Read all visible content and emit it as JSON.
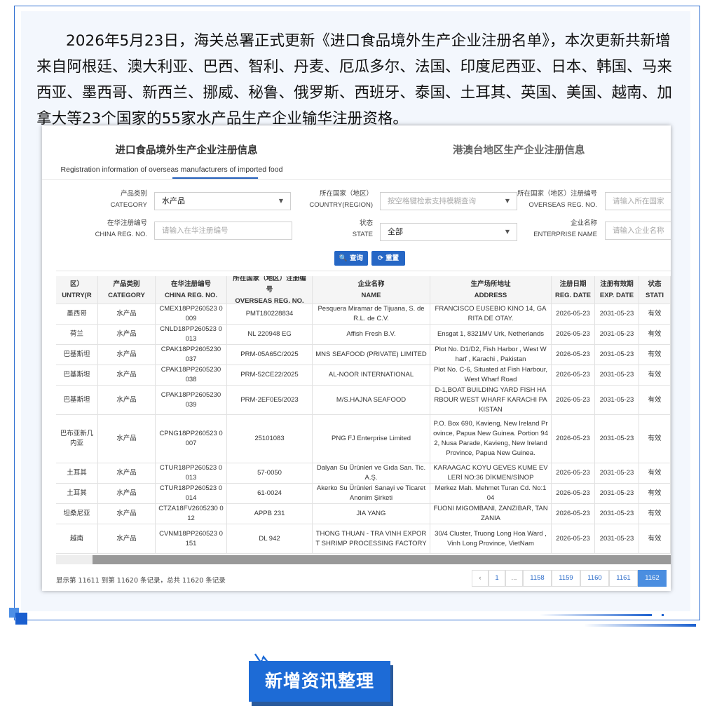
{
  "intro_text": "2026年5月23日，海关总署正式更新《进口食品境外生产企业注册名单》，本次更新共新增来自阿根廷、澳大利亚、巴西、智利、丹麦、厄瓜多尔、法国、印度尼西亚、日本、韩国、马来西亚、墨西哥、新西兰、挪威、秘鲁、俄罗斯、西班牙、泰国、土耳其、英国、美国、越南、加拿大等23个国家的55家水产品生产企业输华注册资格。",
  "tabs": {
    "main_cn": "进口食品境外生产企业注册信息",
    "main_en": "Registration information of overseas manufacturers of imported food",
    "second_cn": "港澳台地区生产企业注册信息"
  },
  "filters": {
    "category": {
      "label_cn": "产品类别",
      "label_en": "CATEGORY",
      "value": "水产品"
    },
    "country": {
      "label_cn": "所在国家（地区）",
      "label_en": "COUNTRY(REGION)",
      "placeholder": "按空格键检索支持模糊查询"
    },
    "overseas_reg": {
      "label_cn": "所在国家（地区）注册编号",
      "label_en": "OVERSEAS REG. NO.",
      "placeholder": "请输入所在国家"
    },
    "china_reg": {
      "label_cn": "在华注册编号",
      "label_en": "CHINA REG. NO.",
      "placeholder": "请输入在华注册编号"
    },
    "state": {
      "label_cn": "状态",
      "label_en": "STATE",
      "value": "全部"
    },
    "enterprise": {
      "label_cn": "企业名称",
      "label_en": "ENTERPRISE NAME",
      "placeholder": "请输入企业名称"
    }
  },
  "buttons": {
    "query": "🔍 查询",
    "reset": "⟳ 重置"
  },
  "table": {
    "headers": [
      {
        "cn": "国家（地区）",
        "en": "UNTRY(RE..."
      },
      {
        "cn": "产品类别",
        "en": "CATEGORY"
      },
      {
        "cn": "在华注册编号",
        "en": "CHINA REG. NO."
      },
      {
        "cn": "所在国家（地区）注册编号",
        "en": "OVERSEAS REG. NO."
      },
      {
        "cn": "企业名称",
        "en": "NAME"
      },
      {
        "cn": "生产场所地址",
        "en": "ADDRESS"
      },
      {
        "cn": "注册日期",
        "en": "REG. DATE"
      },
      {
        "cn": "注册有效期",
        "en": "EXP. DATE"
      },
      {
        "cn": "状态",
        "en": "STATI"
      }
    ],
    "rows": [
      [
        "墨西哥",
        "水产品",
        "CMEX18PP260523 0009",
        "PMT180228834",
        "Pesquera Miramar de Tijuana, S. de R.L. de C.V.",
        "FRANCISCO EUSEBIO KINO 14, GARITA DE OTAY.",
        "2026-05-23",
        "2031-05-23",
        "有效"
      ],
      [
        "荷兰",
        "水产品",
        "CNLD18PP260523 0013",
        "NL 220948 EG",
        "Affish Fresh B.V.",
        "Ensgat 1, 8321MV Urk, Netherlands",
        "2026-05-23",
        "2031-05-23",
        "有效"
      ],
      [
        "巴基斯坦",
        "水产品",
        "CPAK18PP2605230 037",
        "PRM-05A65C/2025",
        "MNS SEAFOOD (PRIVATE) LIMITED",
        "Plot No. D1/D2, Fish Harbor , West Wharf , Karachi , Pakistan",
        "2026-05-23",
        "2031-05-23",
        "有效"
      ],
      [
        "巴基斯坦",
        "水产品",
        "CPAK18PP2605230 038",
        "PRM-52CE22/2025",
        "AL-NOOR INTERNATIONAL",
        "Plot No. C-6, Situated at Fish Harbour, West Wharf Road",
        "2026-05-23",
        "2031-05-23",
        "有效"
      ],
      [
        "巴基斯坦",
        "水产品",
        "CPAK18PP2605230 039",
        "PRM-2EF0E5/2023",
        "M/S.HAJNA SEAFOOD",
        "D-1,BOAT BUILDING YARD FISH HARBOUR WEST WHARF KARACHI PAKISTAN",
        "2026-05-23",
        "2031-05-23",
        "有效"
      ],
      [
        "巴布亚新几内亚",
        "水产品",
        "CPNG18PP260523 0007",
        "25101083",
        "PNG FJ Enterprise Limited",
        "P.O. Box 690, Kavieng, New Ireland Province, Papua New Guinea. Portion 942, Nusa Parade, Kavieng, New Ireland Province, Papua New Guinea.",
        "2026-05-23",
        "2031-05-23",
        "有效"
      ],
      [
        "土耳其",
        "水产品",
        "CTUR18PP260523 0013",
        "57-0050",
        "Dalyan Su Ürünleri ve Gıda San. Tic. A.Ş.",
        "KARAAGAC KOYU GEVES KUME EVLERİ NO:36 DİKMEN/SİNOP",
        "2026-05-23",
        "2031-05-23",
        "有效"
      ],
      [
        "土耳其",
        "水产品",
        "CTUR18PP260523 0014",
        "61-0024",
        "Akerko Su Ürünleri Sanayi ve Ticaret Anonim Şirketi",
        "Merkez Mah. Mehmet Turan Cd. No:104",
        "2026-05-23",
        "2031-05-23",
        "有效"
      ],
      [
        "坦桑尼亚",
        "水产品",
        "CTZA18FV2605230 012",
        "APPB 231",
        "JIA YANG",
        "FUONI MIGOMBANI, ZANZIBAR, TANZANIA",
        "2026-05-23",
        "2031-05-23",
        "有效"
      ],
      [
        "越南",
        "水产品",
        "CVNM18PP260523 0151",
        "DL 942",
        "THONG THUAN - TRA VINH EXPORT SHRIMP PROCESSING FACTORY",
        "30/4 Cluster, Truong Long Hoa Ward , Vinh Long Province, VietNam",
        "2026-05-23",
        "2031-05-23",
        "有效"
      ]
    ]
  },
  "footer": {
    "record_info": "显示第 11611 到第 11620 条记录，总共 11620 条记录",
    "pages": [
      "‹",
      "1",
      "...",
      "1158",
      "1159",
      "1160",
      "1161",
      "1162"
    ],
    "active_page": "1162"
  },
  "badge_text": "新增资讯整理",
  "colors": {
    "accent": "#1d6bd6",
    "frame": "#2f6fd0",
    "button": "#2667c5",
    "active_page": "#4b8ee0"
  }
}
